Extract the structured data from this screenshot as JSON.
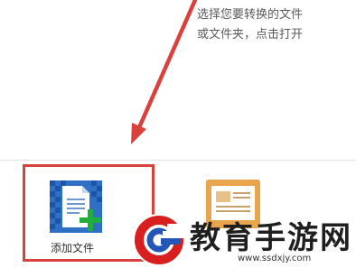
{
  "instruction": {
    "line1": "选择您要转换的文件",
    "line2": "或文件夹，点击打开"
  },
  "add_file": {
    "label": "添加文件",
    "icon": "add-file-icon"
  },
  "open_folder": {
    "icon": "folder-icon"
  },
  "watermark": {
    "title": "教育手游网",
    "url": "www.ssdxjy.com"
  },
  "colors": {
    "highlight": "#d9413d",
    "icon_blue": "#2f6fc4",
    "plus_green": "#1fae3b",
    "folder_orange": "#e8a54b"
  }
}
